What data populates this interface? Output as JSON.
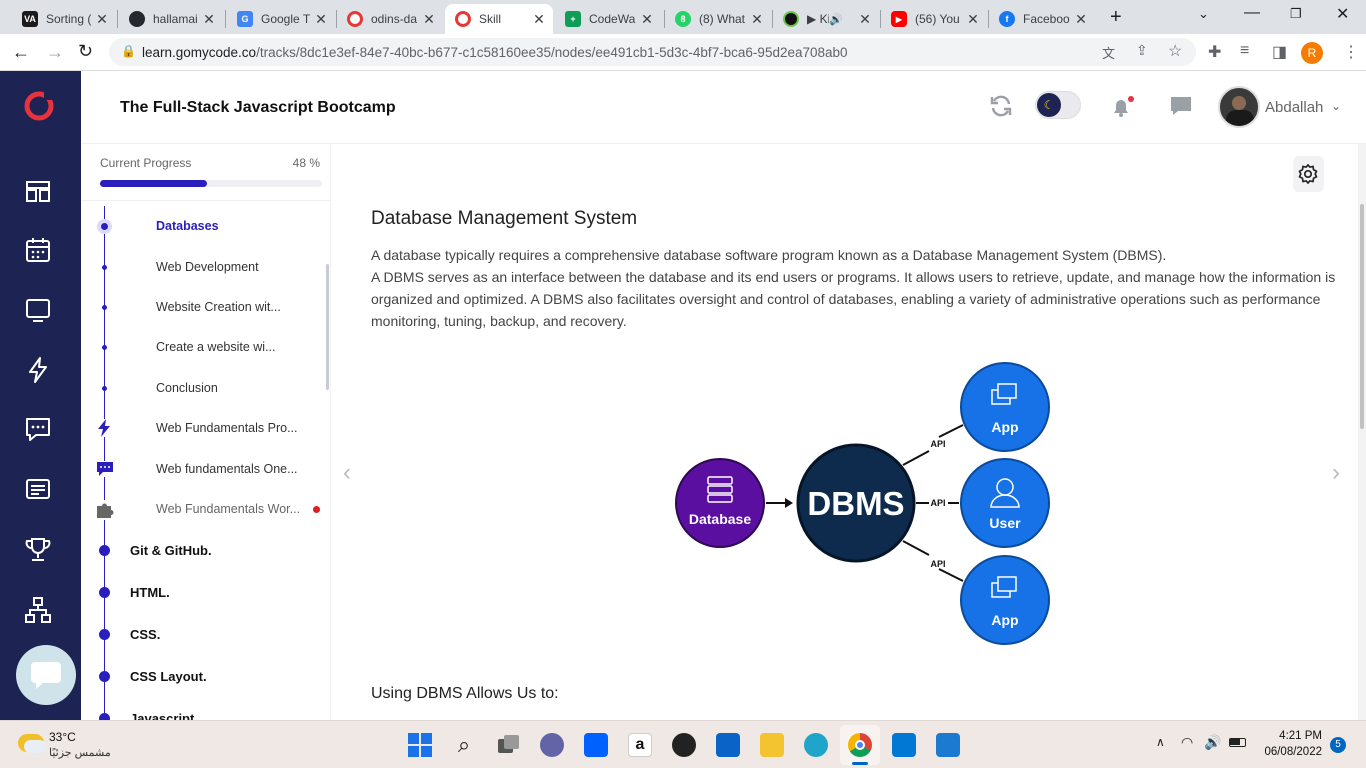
{
  "browser": {
    "tabs": [
      {
        "title": "Sorting (",
        "icon": "visualgo-icon",
        "color": "#1b1b1b"
      },
      {
        "title": "hallamai",
        "icon": "github-icon",
        "color": "#24292f"
      },
      {
        "title": "Google T",
        "icon": "google-translate-icon",
        "color": "#4285f4"
      },
      {
        "title": "odins-da",
        "icon": "odin-icon",
        "color": "#e53935"
      },
      {
        "title": "Skill",
        "icon": "gomycode-icon",
        "color": "#e53935",
        "active": true
      },
      {
        "title": "CodeWa",
        "icon": "sheets-icon",
        "color": "#0f9d58"
      },
      {
        "title": "(8) What",
        "icon": "whatsapp-icon",
        "color": "#25d366"
      },
      {
        "title": "▶ Ki",
        "icon": "media-icon",
        "color": "#111111"
      },
      {
        "title": "(56) You",
        "icon": "youtube-icon",
        "color": "#ff0000"
      },
      {
        "title": "Faceboo",
        "icon": "facebook-icon",
        "color": "#1877f2"
      }
    ],
    "url_host": "learn.gomycode.co",
    "url_path": "/tracks/8dc1e3ef-84e7-40bc-b677-c1c58160ee35/nodes/ee491cb1-5d3c-4bf7-bca6-95d2ea708ab0",
    "profile_initial": "R"
  },
  "app": {
    "course_title": "The Full-Stack Javascript Bootcamp",
    "user_name": "Abdallah",
    "brand_color": "#e8333c",
    "nav_color": "#1d2353",
    "accent": "#2a1fbd"
  },
  "progress": {
    "label": "Current Progress",
    "percent_text": "48 %",
    "value": 0.48
  },
  "outline": {
    "subitems": [
      {
        "label": "Databases",
        "active": true,
        "icon": "current-dot"
      },
      {
        "label": "Web Development",
        "icon": "dot"
      },
      {
        "label": "Website Creation wit...",
        "icon": "dot"
      },
      {
        "label": "Create a website wi...",
        "icon": "dot"
      },
      {
        "label": "Conclusion",
        "icon": "dot"
      },
      {
        "label": "Web Fundamentals Pro...",
        "icon": "lightning-icon"
      },
      {
        "label": "Web fundamentals One...",
        "icon": "chat-icon"
      },
      {
        "label": "Web Fundamentals Wor...",
        "icon": "puzzle-icon",
        "alert": true
      }
    ],
    "sections": [
      {
        "label": "Git & GitHub."
      },
      {
        "label": "HTML."
      },
      {
        "label": "CSS."
      },
      {
        "label": "CSS Layout."
      },
      {
        "label": "Javascript"
      }
    ]
  },
  "lesson": {
    "title": "Database Management System",
    "paragraphs": [
      "A database typically requires a comprehensive database software program known as a Database Management System (DBMS).",
      "A DBMS serves as an interface between the database and its end users or programs. It allows users to retrieve, update, and manage how the information is organized and optimized. A DBMS also facilitates oversight and control of databases, enabling a variety of administrative operations such as performance monitoring, tuning, backup, and recovery."
    ],
    "subheading": "Using DBMS Allows Us to:",
    "diagram": {
      "database_label": "Database",
      "dbms_label": "DBMS",
      "api_label": "API",
      "app_label": "App",
      "user_label": "User"
    }
  },
  "taskbar": {
    "temperature": "33°C",
    "weather": "مشمس جزئيًا",
    "time": "4:21 PM",
    "date": "06/08/2022",
    "notifications": "5"
  }
}
